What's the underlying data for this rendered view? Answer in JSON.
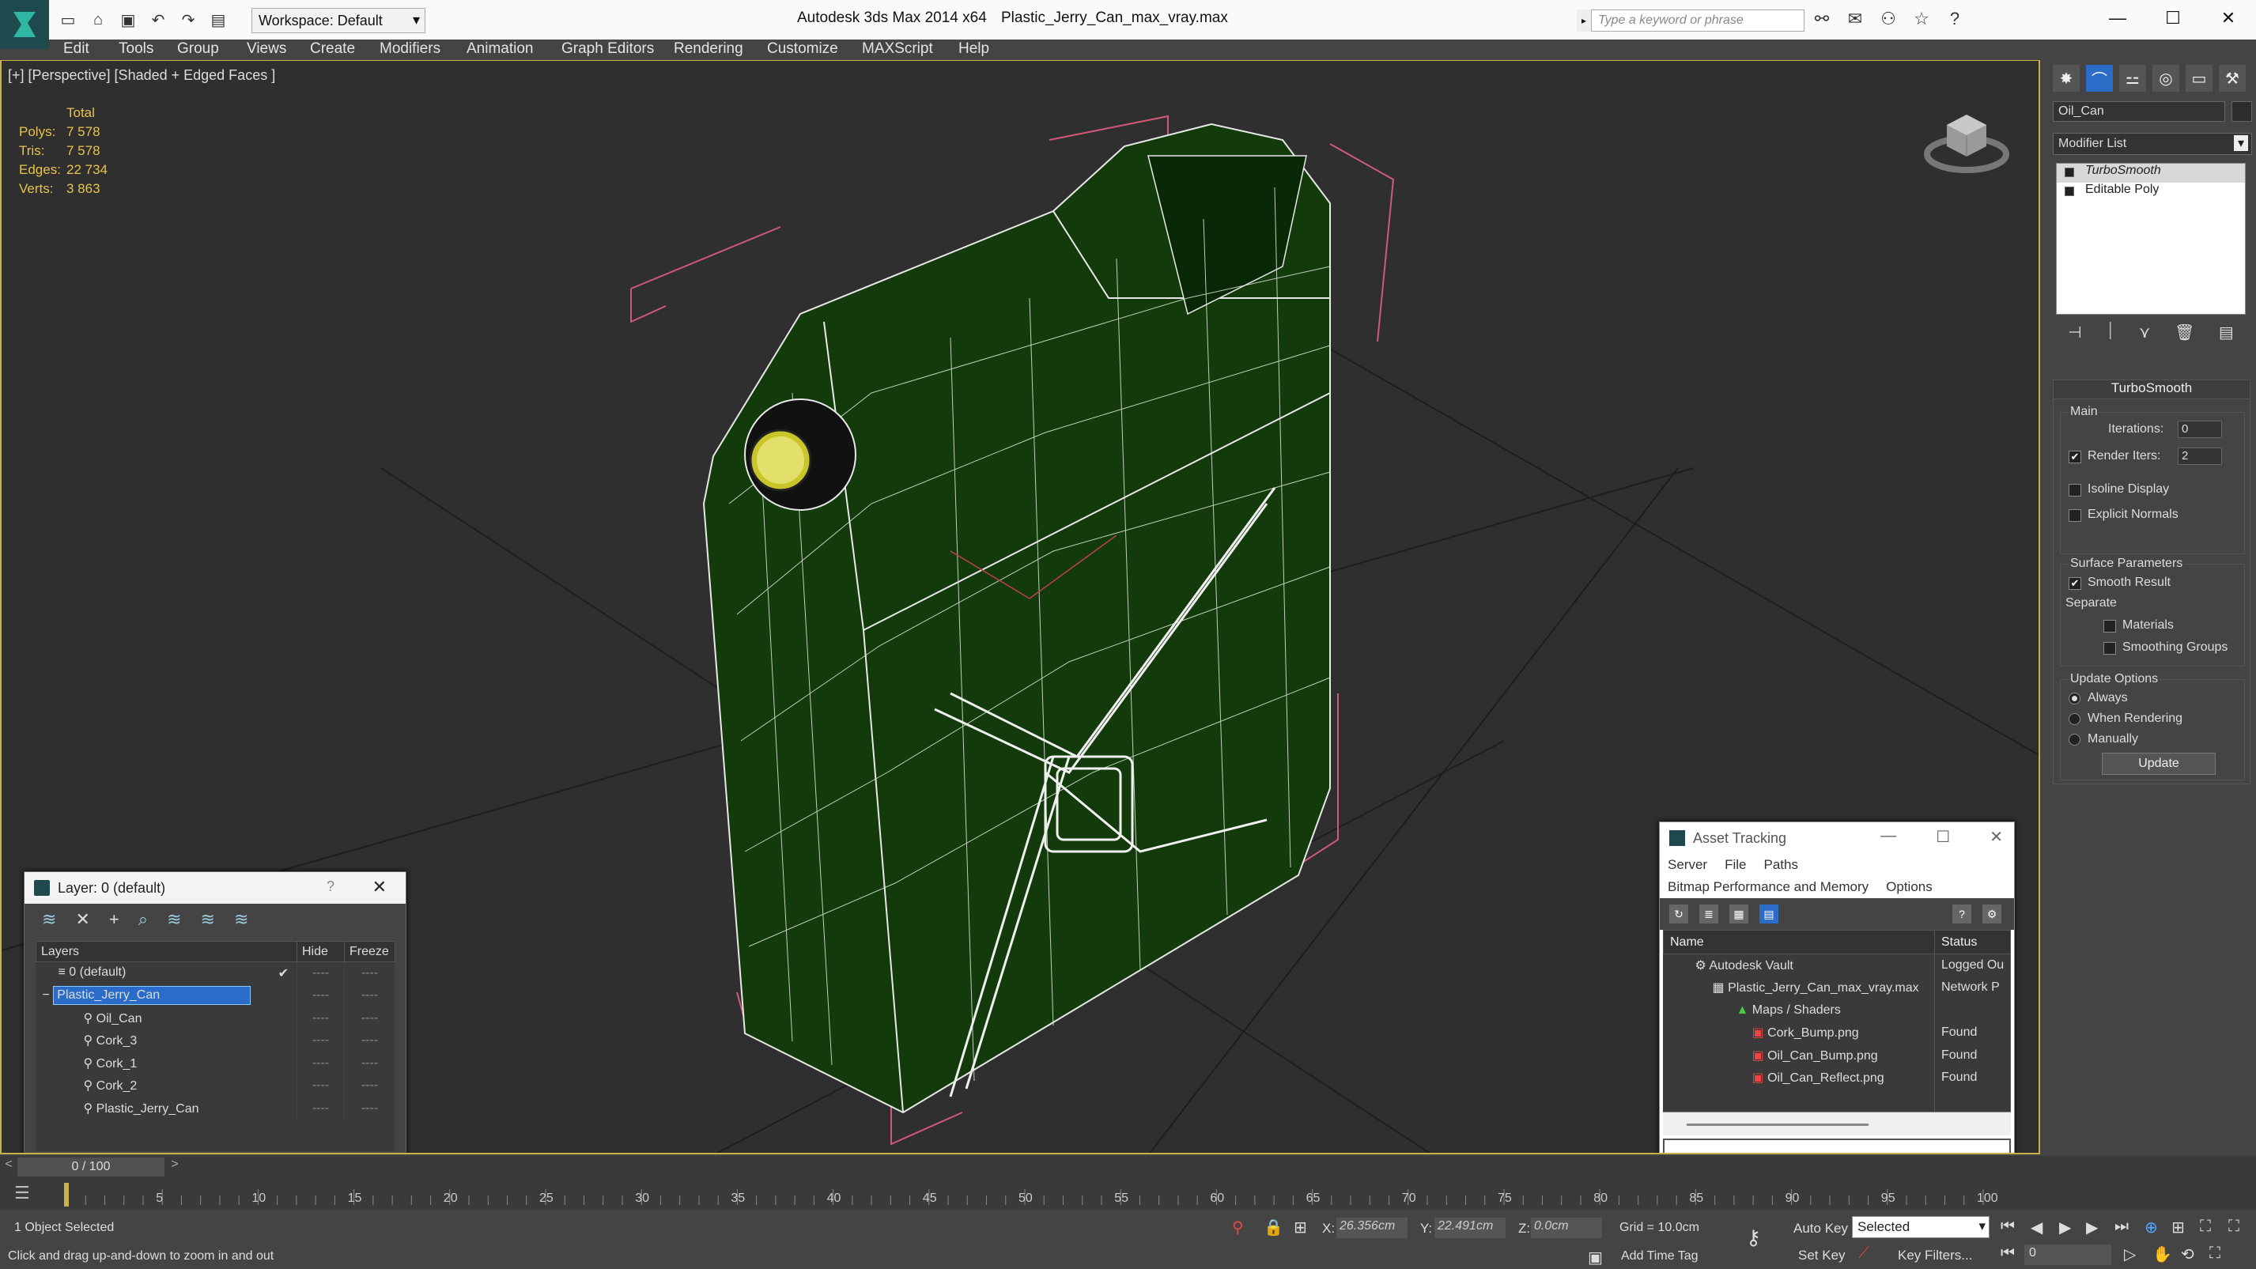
{
  "titlebar": {
    "workspace": "Workspace: Default",
    "app_title": "Autodesk 3ds Max  2014 x64",
    "file_title": "Plastic_Jerry_Can_max_vray.max",
    "search_placeholder": "Type a keyword or phrase"
  },
  "menu": [
    "Edit",
    "Tools",
    "Group",
    "Views",
    "Create",
    "Modifiers",
    "Animation",
    "Graph Editors",
    "Rendering",
    "Customize",
    "MAXScript",
    "Help"
  ],
  "viewport": {
    "label": "[+] [Perspective] [Shaded + Edged Faces ]",
    "stats": {
      "total_label": "Total",
      "rows": [
        {
          "k": "Polys:",
          "v": "7 578"
        },
        {
          "k": "Tris:",
          "v": "7 578"
        },
        {
          "k": "Edges:",
          "v": "22 734"
        },
        {
          "k": "Verts:",
          "v": "3 863"
        }
      ]
    }
  },
  "layer_window": {
    "title": "Layer: 0 (default)",
    "help": "?",
    "columns": [
      "Layers",
      "Hide",
      "Freeze"
    ],
    "rows": [
      {
        "name": "0 (default)",
        "indent": 1
      },
      {
        "name": "Plastic_Jerry_Can",
        "indent": 1,
        "selected": true
      },
      {
        "name": "Oil_Can",
        "indent": 2
      },
      {
        "name": "Cork_3",
        "indent": 2
      },
      {
        "name": "Cork_1",
        "indent": 2
      },
      {
        "name": "Cork_2",
        "indent": 2
      },
      {
        "name": "Plastic_Jerry_Can",
        "indent": 2
      }
    ],
    "dash": "----"
  },
  "asset_window": {
    "title": "Asset Tracking",
    "menu1": [
      "Server",
      "File",
      "Paths"
    ],
    "menu2": [
      "Bitmap Performance and Memory",
      "Options"
    ],
    "columns": [
      "Name",
      "Status"
    ],
    "rows": [
      {
        "name": "Autodesk Vault",
        "status": "Logged Ou",
        "indent": 1
      },
      {
        "name": "Plastic_Jerry_Can_max_vray.max",
        "status": "Network P",
        "indent": 2
      },
      {
        "name": "Maps / Shaders",
        "status": "",
        "indent": 3
      },
      {
        "name": "Cork_Bump.png",
        "status": "Found",
        "indent": 4
      },
      {
        "name": "Oil_Can_Bump.png",
        "status": "Found",
        "indent": 4
      },
      {
        "name": "Oil_Can_Reflect.png",
        "status": "Found",
        "indent": 4
      }
    ]
  },
  "command_panel": {
    "object_name": "Oil_Can",
    "modifier_list": "Modifier List",
    "stack": [
      "TurboSmooth",
      "Editable Poly"
    ],
    "turbosmooth": {
      "header": "TurboSmooth",
      "main": "Main",
      "iterations_label": "Iterations:",
      "iterations": "0",
      "render_iters_label": "Render Iters:",
      "render_iters": "2",
      "isoline": "Isoline Display",
      "explicit": "Explicit Normals",
      "surface": "Surface Parameters",
      "smooth_result": "Smooth Result",
      "separate": "Separate",
      "materials": "Materials",
      "smoothing_groups": "Smoothing Groups",
      "update_options": "Update Options",
      "always": "Always",
      "when_rendering": "When Rendering",
      "manually": "Manually",
      "update": "Update"
    }
  },
  "timeline": {
    "frame": "0 / 100",
    "ticks": [
      "5",
      "10",
      "15",
      "20",
      "25",
      "30",
      "35",
      "40",
      "45",
      "50",
      "55",
      "60",
      "65",
      "70",
      "75",
      "80",
      "85",
      "90",
      "95",
      "100"
    ]
  },
  "status": {
    "selected": "1 Object Selected",
    "prompt": "Click and drag up-and-down to zoom in and out",
    "x_label": "X:",
    "x": "26.356cm",
    "y_label": "Y:",
    "y": "22.491cm",
    "z_label": "Z:",
    "z": "0.0cm",
    "grid": "Grid = 10.0cm",
    "add_time_tag": "Add Time Tag",
    "auto_key": "Auto Key",
    "set_key": "Set Key",
    "selection_set": "Selected",
    "key_filters": "Key Filters...",
    "time": "0"
  }
}
